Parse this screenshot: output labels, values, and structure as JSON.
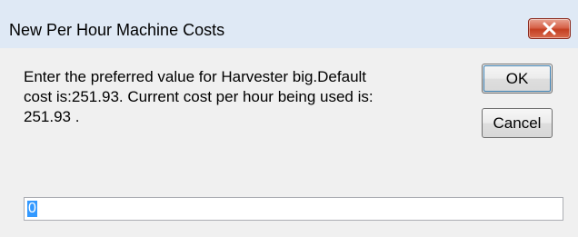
{
  "window": {
    "title": "New Per Hour Machine Costs"
  },
  "message": {
    "line1": "Enter the preferred value for Harvester big.Default",
    "line2": "cost is:251.93.  Current cost per hour being used is:",
    "line3": "251.93 ."
  },
  "buttons": {
    "ok_label": "OK",
    "cancel_label": "Cancel"
  },
  "input": {
    "value": "0",
    "selected": true
  },
  "colors": {
    "titlebar": "#dfe9f5",
    "body": "#f0f0f0",
    "close_button": "#c43f22",
    "selection": "#3399ff"
  },
  "icons": {
    "close": "close-icon"
  }
}
